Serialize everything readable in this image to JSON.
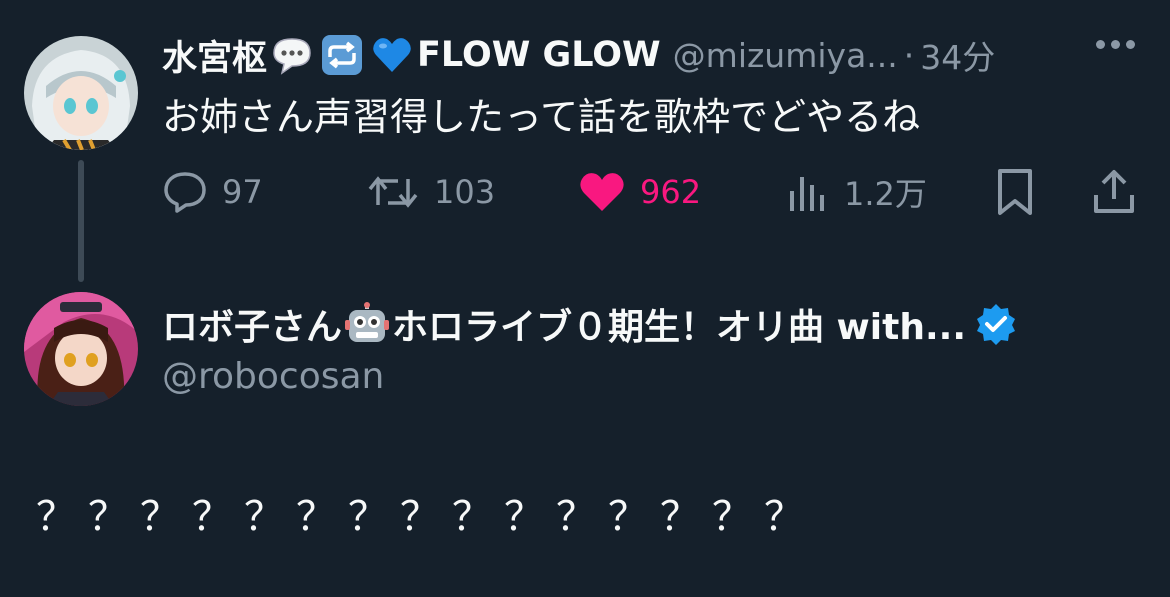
{
  "tweet": {
    "display_name": "水宮枢",
    "name_suffix": "FLOW GLOW",
    "handle": "@mizumiya...",
    "separator": "·",
    "time": "34分",
    "text": "お姉さん声習得したって話を歌枠でどやるね",
    "icons": [
      "speech-bubble-emoji",
      "repeat-button-emoji",
      "blue-heart-emoji"
    ],
    "actions": {
      "reply_count": "97",
      "retweet_count": "103",
      "like_count": "962",
      "view_count": "1.2万"
    },
    "like_color": "#f91880"
  },
  "profile": {
    "display_name": "ロボ子さん",
    "name_suffix": "ホロライブ０期生！オリ曲 with...",
    "handle": "@robocosan",
    "verified": true,
    "verified_color": "#1d9bf0",
    "icons": [
      "robot-emoji",
      "verified-badge-icon"
    ]
  },
  "body_text": "？？？？？？？？？？？？？？？",
  "colors": {
    "background": "#15202b",
    "text": "#f7f9f9",
    "muted": "#8b98a5"
  }
}
